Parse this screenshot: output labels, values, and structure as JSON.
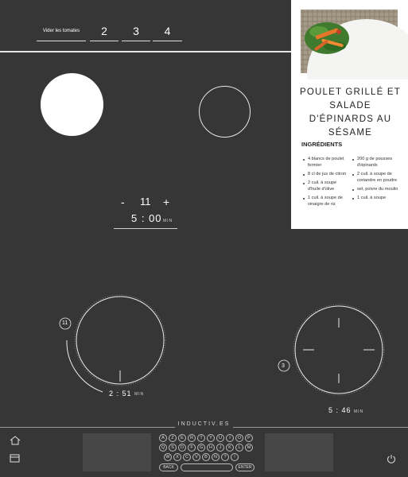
{
  "steps": {
    "main_label": "Vider les tomates",
    "labels": [
      "2",
      "3",
      "4"
    ]
  },
  "timer_center": {
    "minus": "-",
    "level": "11",
    "plus": "+",
    "time": "5 : 00",
    "unit": "MIN"
  },
  "burner_left": {
    "level": "11",
    "time": "2 : 51",
    "unit": "MIN",
    "arc_fill": 0.3
  },
  "burner_right": {
    "level": "3",
    "time": "5 : 46",
    "unit": "MIN"
  },
  "recipe": {
    "title": "POULET GRILLÉ ET SALADE D'ÉPINARDS AU SÉSAME",
    "ingredients_heading": "INGRÉDIENTS",
    "col1": [
      "4 blancs de poulet fermier",
      "8 cl de jus de citron",
      "2 cuil. à soupe d'huile d'olive",
      "1 cuil. à soupe de vinaigre de riz"
    ],
    "col2": [
      "200 g de pousses d'épinards",
      "2 cuil. à soupe de coriandre en poudre",
      "sel, poivre du moulin",
      "1 cuil. à soupe"
    ]
  },
  "bottom": {
    "brand": "INDUCTIV.ES",
    "keys_row1": [
      "A",
      "Z",
      "E",
      "R",
      "T",
      "Y",
      "U",
      "I",
      "O",
      "P"
    ],
    "keys_row2": [
      "Q",
      "S",
      "D",
      "F",
      "G",
      "H",
      "J",
      "K",
      "L",
      "M"
    ],
    "keys_row3": [
      "W",
      "X",
      "C",
      "V",
      "B",
      "N",
      "?",
      "!"
    ],
    "back_label": "BACK",
    "enter_label": "ENTER"
  },
  "icons": {
    "home": "home-icon",
    "calendar": "calendar-icon",
    "power": "power-icon"
  },
  "colors": {
    "background": "#363636",
    "pad": "#474747",
    "accent": "#ffffff"
  }
}
